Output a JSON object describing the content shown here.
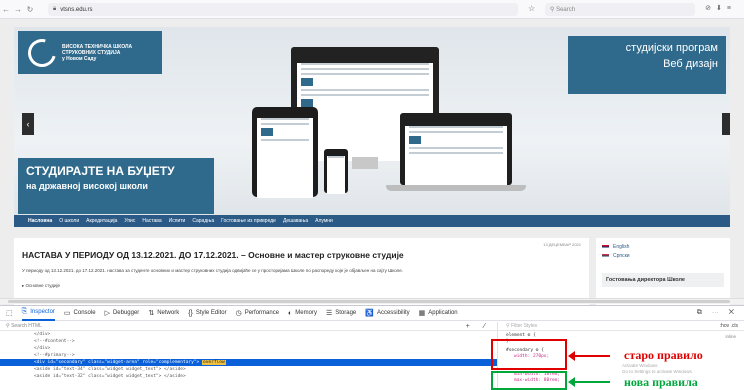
{
  "browser": {
    "url": "vtsns.edu.rs",
    "search_placeholder": "Search"
  },
  "site": {
    "logo_lines": [
      "ВИСОКА ТЕХНИЧКА ШКОЛА",
      "СТРУКОВНИХ СТУДИЈА",
      "у Новом Саду"
    ],
    "program_line1": "студијски програм",
    "program_line2": "Веб дизајн",
    "enroll_line1": "СТУДИРАЈТЕ НА БУЏЕТУ",
    "enroll_line2": "на државној високој школи",
    "nav": [
      "Насловна",
      "О школи",
      "Акредитација",
      "Упис",
      "Настава",
      "Испити",
      "Сарадња",
      "Гостовање из привреде",
      "Дешавања",
      "Алумни"
    ],
    "post_date": "13 ДЕЦЕМБАР 2021",
    "post_title": "НАСТАВА У ПЕРИОДУ ОД 13.12.2021. ДО 17.12.2021. – Основне и мастер струковне студије",
    "post_text": "У периоду од 13.12.2021. до 17.12.2021. настава за студенте основних и мастер струковних студија одвијаће се у просторијама Школе по распореду које је објављен на сајту Школе.",
    "post_tag": "▸ Основне студије",
    "lang_en": "English",
    "lang_sr": "Српски",
    "guestbook": "Гостовања директора Школе"
  },
  "devtools": {
    "tabs": [
      {
        "icon": "⎘",
        "label": "Inspector"
      },
      {
        "icon": "▭",
        "label": "Console"
      },
      {
        "icon": "▷",
        "label": "Debugger"
      },
      {
        "icon": "⇅",
        "label": "Network"
      },
      {
        "icon": "{}",
        "label": "Style Editor"
      },
      {
        "icon": "◷",
        "label": "Performance"
      },
      {
        "icon": "◐",
        "label": "Memory"
      },
      {
        "icon": "☰",
        "label": "Storage"
      },
      {
        "icon": "♿",
        "label": "Accessibility"
      },
      {
        "icon": "▦",
        "label": "Application"
      }
    ],
    "search_html": "Search HTML",
    "filter_styles": "Filter Styles",
    "hov_cls": ":hov .cls",
    "code_lines": [
      "</div>",
      "<!--#content-->",
      "</div>",
      "<!--#primary-->",
      "<div id=\"secondary\" class=\"widget-area\" role=\"complementary\">",
      "<aside id=\"text-34\" class=\"widget widget_text\"> </aside>",
      "<aside id=\"text-32\" class=\"widget widget_text\"> </aside>"
    ],
    "overflow_badge": "overflow",
    "rule_element": "element ⚙ {",
    "rule_close": "}",
    "rule_selector": "#secondary ⚙ {",
    "rule_prop1": "width: 270px;",
    "rule_prop2": "min-width: 18rem;",
    "rule_prop3": "max-width: 80rem;",
    "inline_label": "inline",
    "activate_line1": "Activate Windows",
    "activate_line2": "Go to Settings to activate Windows."
  },
  "annotations": {
    "old_rule": "старо правило",
    "new_rules": "нова правила"
  }
}
